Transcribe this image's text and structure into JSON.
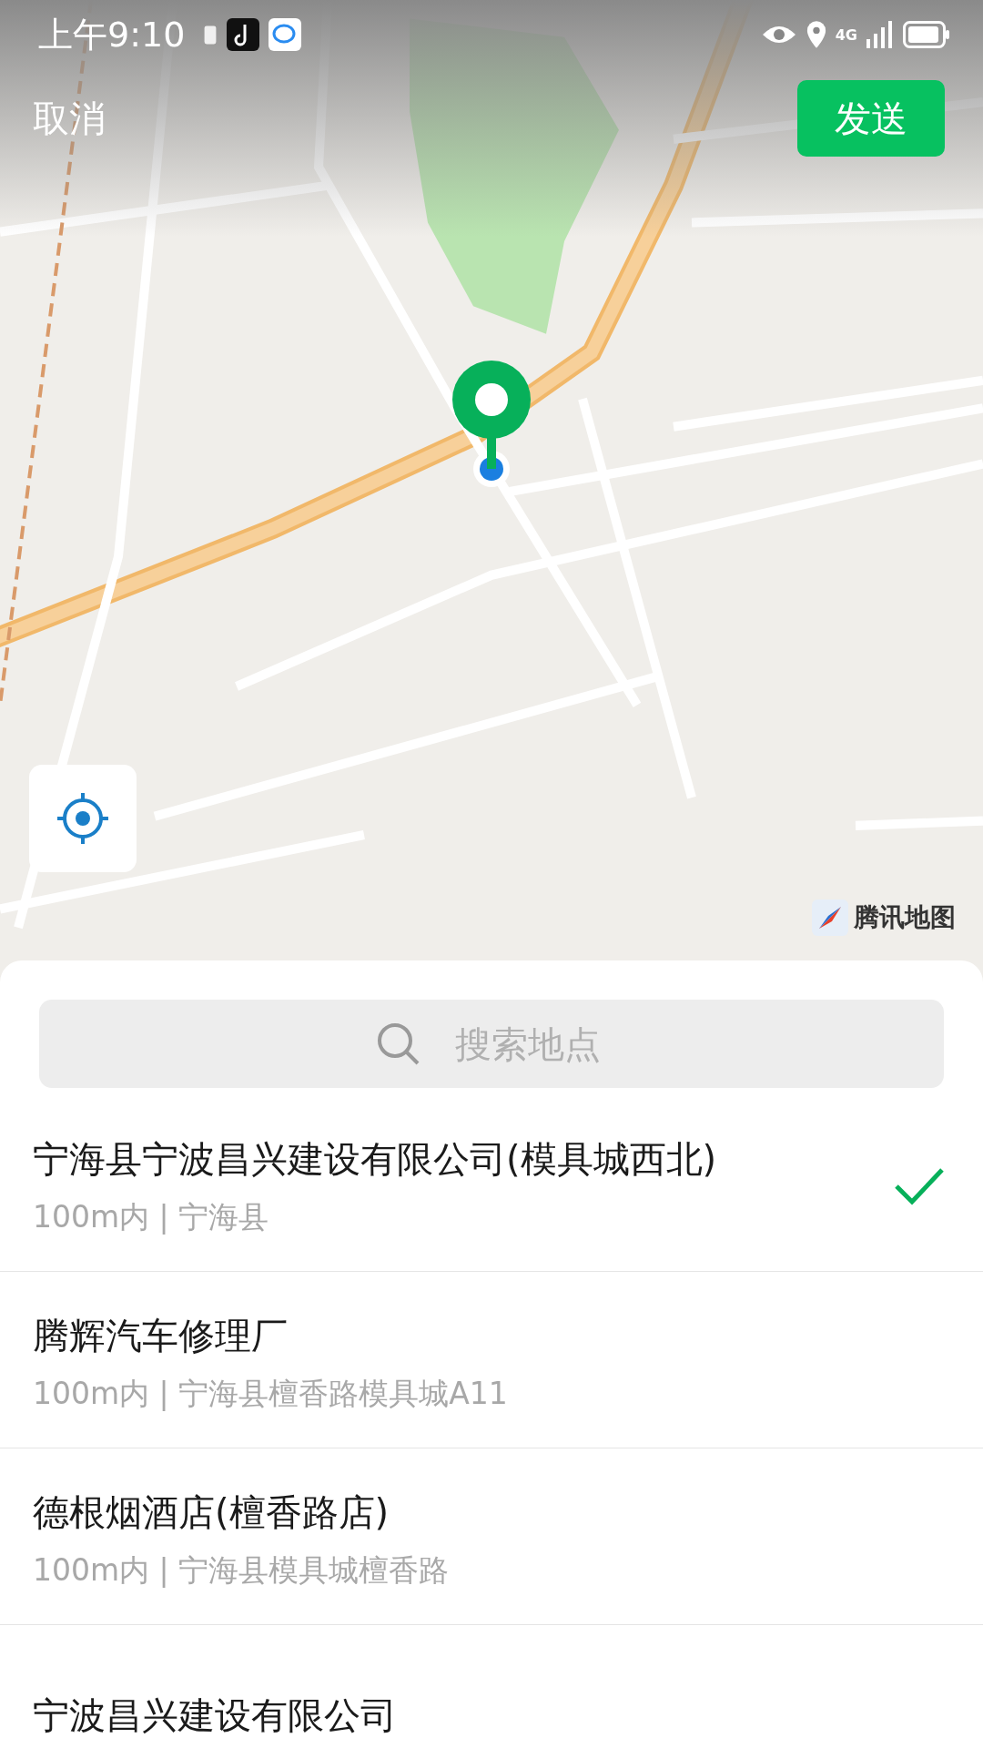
{
  "status_bar": {
    "time": "上午9:10",
    "network": "4G"
  },
  "header": {
    "cancel": "取消",
    "send": "发送"
  },
  "map": {
    "logo": "腾讯地图"
  },
  "search": {
    "placeholder": "搜索地点"
  },
  "places": [
    {
      "name": "宁海县宁波昌兴建设有限公司(模具城西北)",
      "detail": "100m内 | 宁海县",
      "selected": true
    },
    {
      "name": "腾辉汽车修理厂",
      "detail": "100m内 | 宁海县檀香路模具城A11",
      "selected": false
    },
    {
      "name": "德根烟酒店(檀香路店)",
      "detail": "100m内 | 宁海县模具城檀香路",
      "selected": false
    },
    {
      "name": "宁波昌兴建设有限公司",
      "selected": false
    }
  ]
}
